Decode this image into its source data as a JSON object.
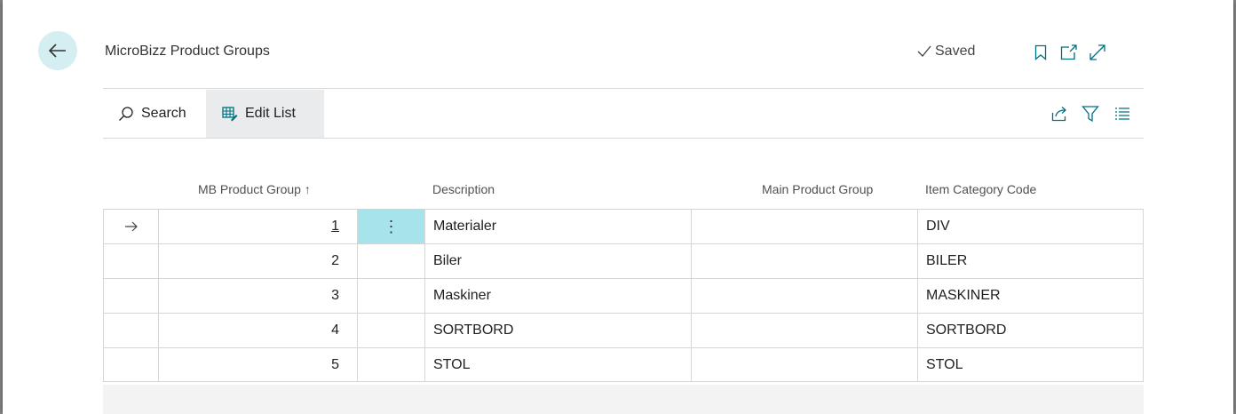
{
  "header": {
    "title": "MicroBizz Product Groups",
    "saved_label": "Saved",
    "icons": [
      "back-arrow-icon",
      "bookmark-icon",
      "open-new-window-icon",
      "expand-icon"
    ]
  },
  "actions": {
    "search_label": "Search",
    "edit_list_label": "Edit List",
    "right_icons": [
      "share-icon",
      "filter-icon",
      "list-view-icon"
    ]
  },
  "table": {
    "columns": {
      "product_group": "MB Product Group",
      "description": "Description",
      "main_product_group": "Main Product Group",
      "item_category_code": "Item Category Code"
    },
    "rows": [
      {
        "group": "1",
        "description": "Materialer",
        "main": "",
        "category": "DIV"
      },
      {
        "group": "2",
        "description": "Biler",
        "main": "",
        "category": "BILER"
      },
      {
        "group": "3",
        "description": "Maskiner",
        "main": "",
        "category": "MASKINER"
      },
      {
        "group": "4",
        "description": "SORTBORD",
        "main": "",
        "category": "SORTBORD"
      },
      {
        "group": "5",
        "description": "STOL",
        "main": "",
        "category": "STOL"
      }
    ],
    "selected_row_index": 0
  },
  "colors": {
    "accent": "#a7e3ea",
    "back_button_bg": "#d5eef2",
    "edit_list_bg": "#e9ebec",
    "icon_teal": "#00707f"
  }
}
